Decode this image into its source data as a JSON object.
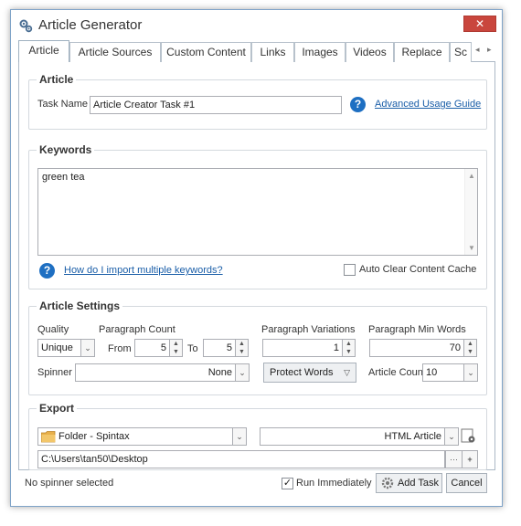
{
  "window": {
    "title": "Article Generator",
    "close_label": "✕"
  },
  "tabs": [
    {
      "label": "Article"
    },
    {
      "label": "Article Sources"
    },
    {
      "label": "Custom Content"
    },
    {
      "label": "Links"
    },
    {
      "label": "Images"
    },
    {
      "label": "Videos"
    },
    {
      "label": "Replace"
    },
    {
      "label": "Sc"
    }
  ],
  "article_group": {
    "title": "Article",
    "task_name_label": "Task Name",
    "task_name_value": "Article Creator Task #1",
    "guide_link": "Advanced Usage Guide"
  },
  "keywords_group": {
    "title": "Keywords",
    "text": "green tea",
    "import_link": "How do I import multiple keywords?",
    "auto_clear_label": "Auto Clear Content Cache",
    "auto_clear_checked": false
  },
  "settings_group": {
    "title": "Article Settings",
    "quality_label": "Quality",
    "quality_value": "Unique",
    "paragraph_count_label": "Paragraph Count",
    "from_label": "From",
    "from_value": "5",
    "to_label": "To",
    "to_value": "5",
    "paragraph_variations_label": "Paragraph Variations",
    "paragraph_variations_value": "1",
    "paragraph_min_words_label": "Paragraph Min Words",
    "paragraph_min_words_value": "70",
    "spinner_label": "Spinner",
    "spinner_value": "None",
    "protect_words_label": "Protect Words",
    "article_count_label": "Article Count",
    "article_count_value": "10"
  },
  "export_group": {
    "title": "Export",
    "folder_value": "Folder - Spintax",
    "format_value": "HTML Article",
    "path_value": "C:\\Users\\tan50\\Desktop",
    "browse_label": "···",
    "add_label": "+"
  },
  "footer": {
    "status_text": "No spinner selected",
    "run_immediately_label": "Run Immediately",
    "run_immediately_checked": true,
    "add_task_label": "Add Task",
    "cancel_label": "Cancel"
  },
  "colors": {
    "accent_link": "#1a5ea8",
    "close_red": "#c9463d",
    "help_blue": "#1e6fc2"
  }
}
